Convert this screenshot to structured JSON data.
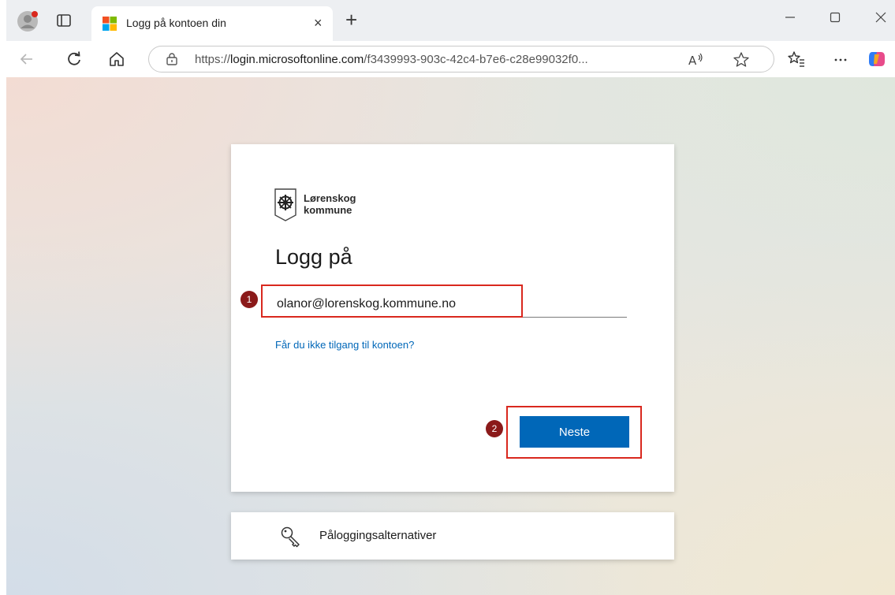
{
  "browser": {
    "tab_title": "Logg på kontoen din",
    "tab_close": "×",
    "new_tab": "+",
    "url_prefix": "https://",
    "url_domain": "login.microsoftonline.com",
    "url_path": "/f3439993-903c-42c4-b7e6-c28e99032f0..."
  },
  "card": {
    "org_name_line1": "Lørenskog",
    "org_name_line2": "kommune",
    "heading": "Logg på",
    "email_value": "olanor@lorenskog.kommune.no",
    "forgot_link": "Får du ikke tilgang til kontoen?",
    "next_button": "Neste"
  },
  "annotations": {
    "step_1": "1",
    "step_2": "2"
  },
  "options": {
    "label": "Påloggingsalternativer"
  },
  "colors": {
    "primary": "#0067b8",
    "highlight": "#d9281e",
    "badge": "#8b1a1a"
  }
}
